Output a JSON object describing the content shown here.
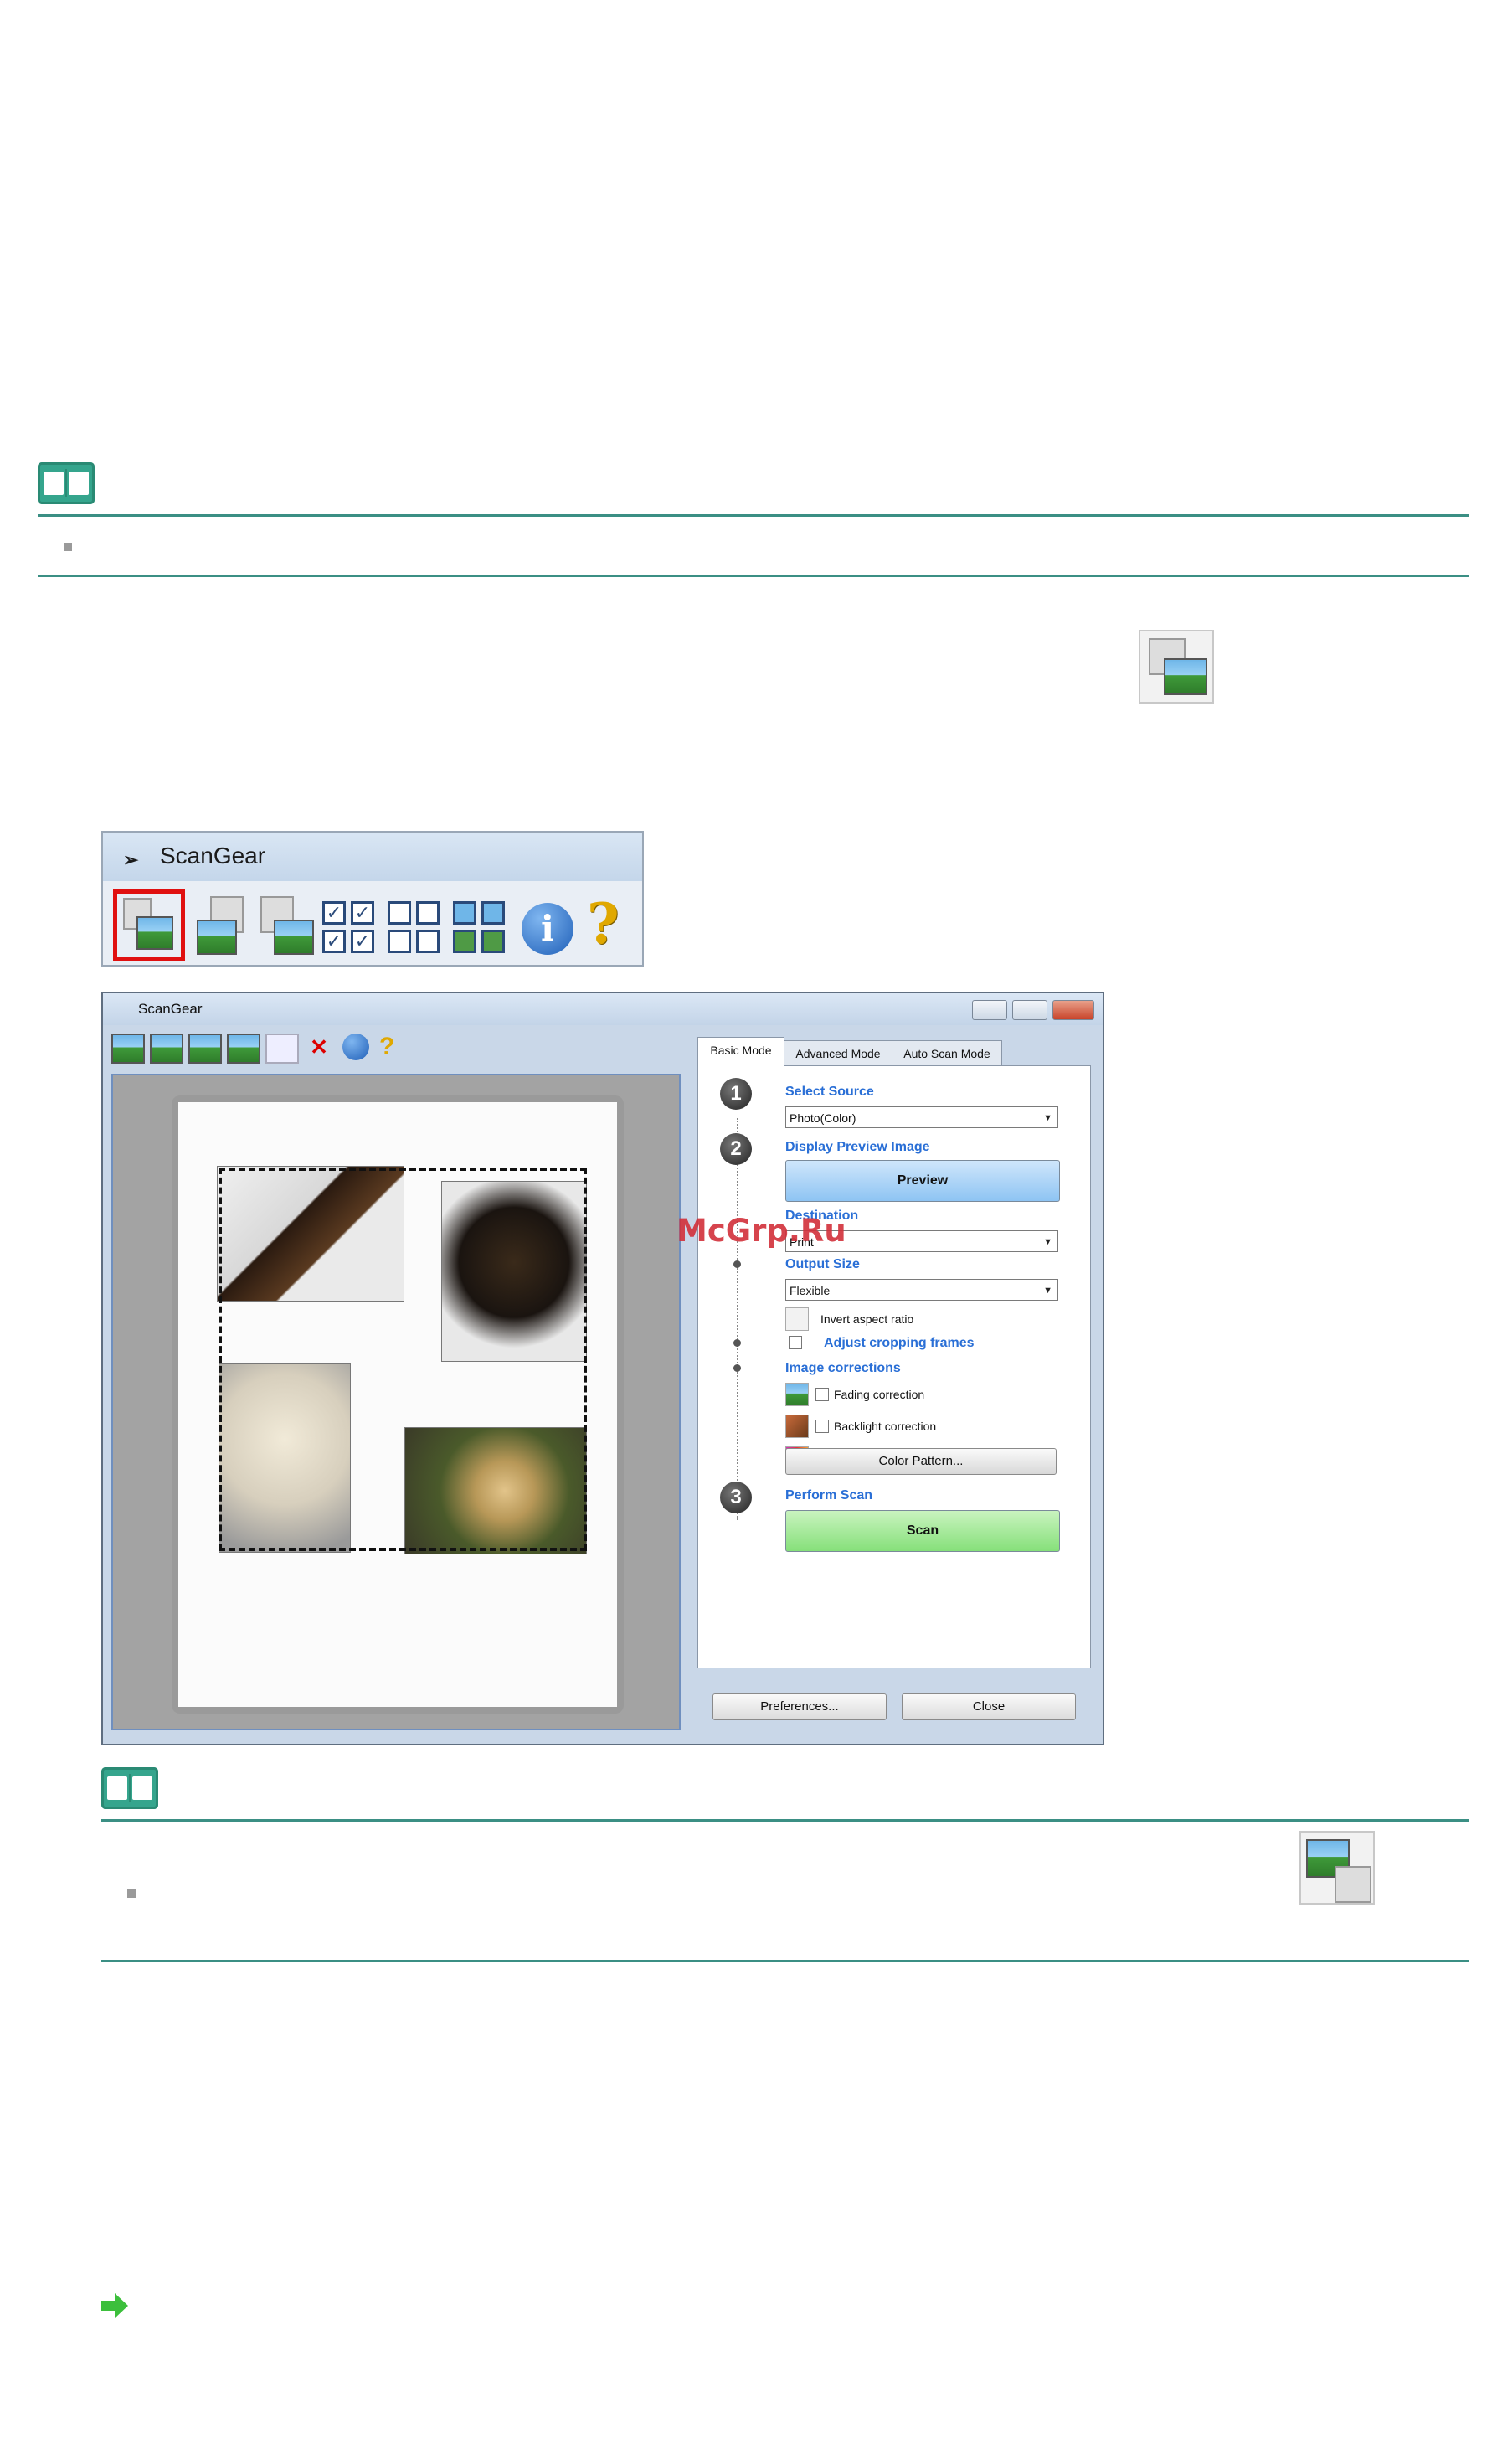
{
  "toolbar_strip": {
    "title": "ScanGear"
  },
  "window": {
    "title": "ScanGear",
    "tabs": [
      {
        "label": "Basic Mode"
      },
      {
        "label": "Advanced Mode"
      },
      {
        "label": "Auto Scan Mode"
      }
    ],
    "steps": {
      "step1": {
        "number": "1",
        "label": "Select Source",
        "value": "Photo(Color)"
      },
      "step2": {
        "number": "2",
        "label": "Display Preview Image",
        "button": "Preview"
      },
      "destination": {
        "label": "Destination",
        "value": "Print"
      },
      "output_size": {
        "label": "Output Size",
        "value": "Flexible"
      },
      "invert": {
        "label": "Invert aspect ratio"
      },
      "adjust": {
        "label": "Adjust cropping frames"
      },
      "corrections": {
        "label": "Image corrections"
      },
      "fading": {
        "label": "Fading correction"
      },
      "backlight": {
        "label": "Backlight correction"
      },
      "color_pattern": {
        "label": "Color Pattern..."
      },
      "step3": {
        "number": "3",
        "label": "Perform Scan",
        "button": "Scan"
      }
    },
    "footer": {
      "preferences": "Preferences...",
      "close": "Close"
    }
  },
  "watermark": "McGrp.Ru",
  "colors": {
    "rule": "#3b8f84",
    "note_icon": "#35a58d",
    "highlight": "#e01010",
    "preview_button": "#8ec4f3",
    "scan_button": "#86e07a",
    "link": "#2a6fd6"
  },
  "icons": [
    "note-icon",
    "scan-multiple-icon",
    "info-icon",
    "help-icon",
    "next-arrow-icon"
  ]
}
